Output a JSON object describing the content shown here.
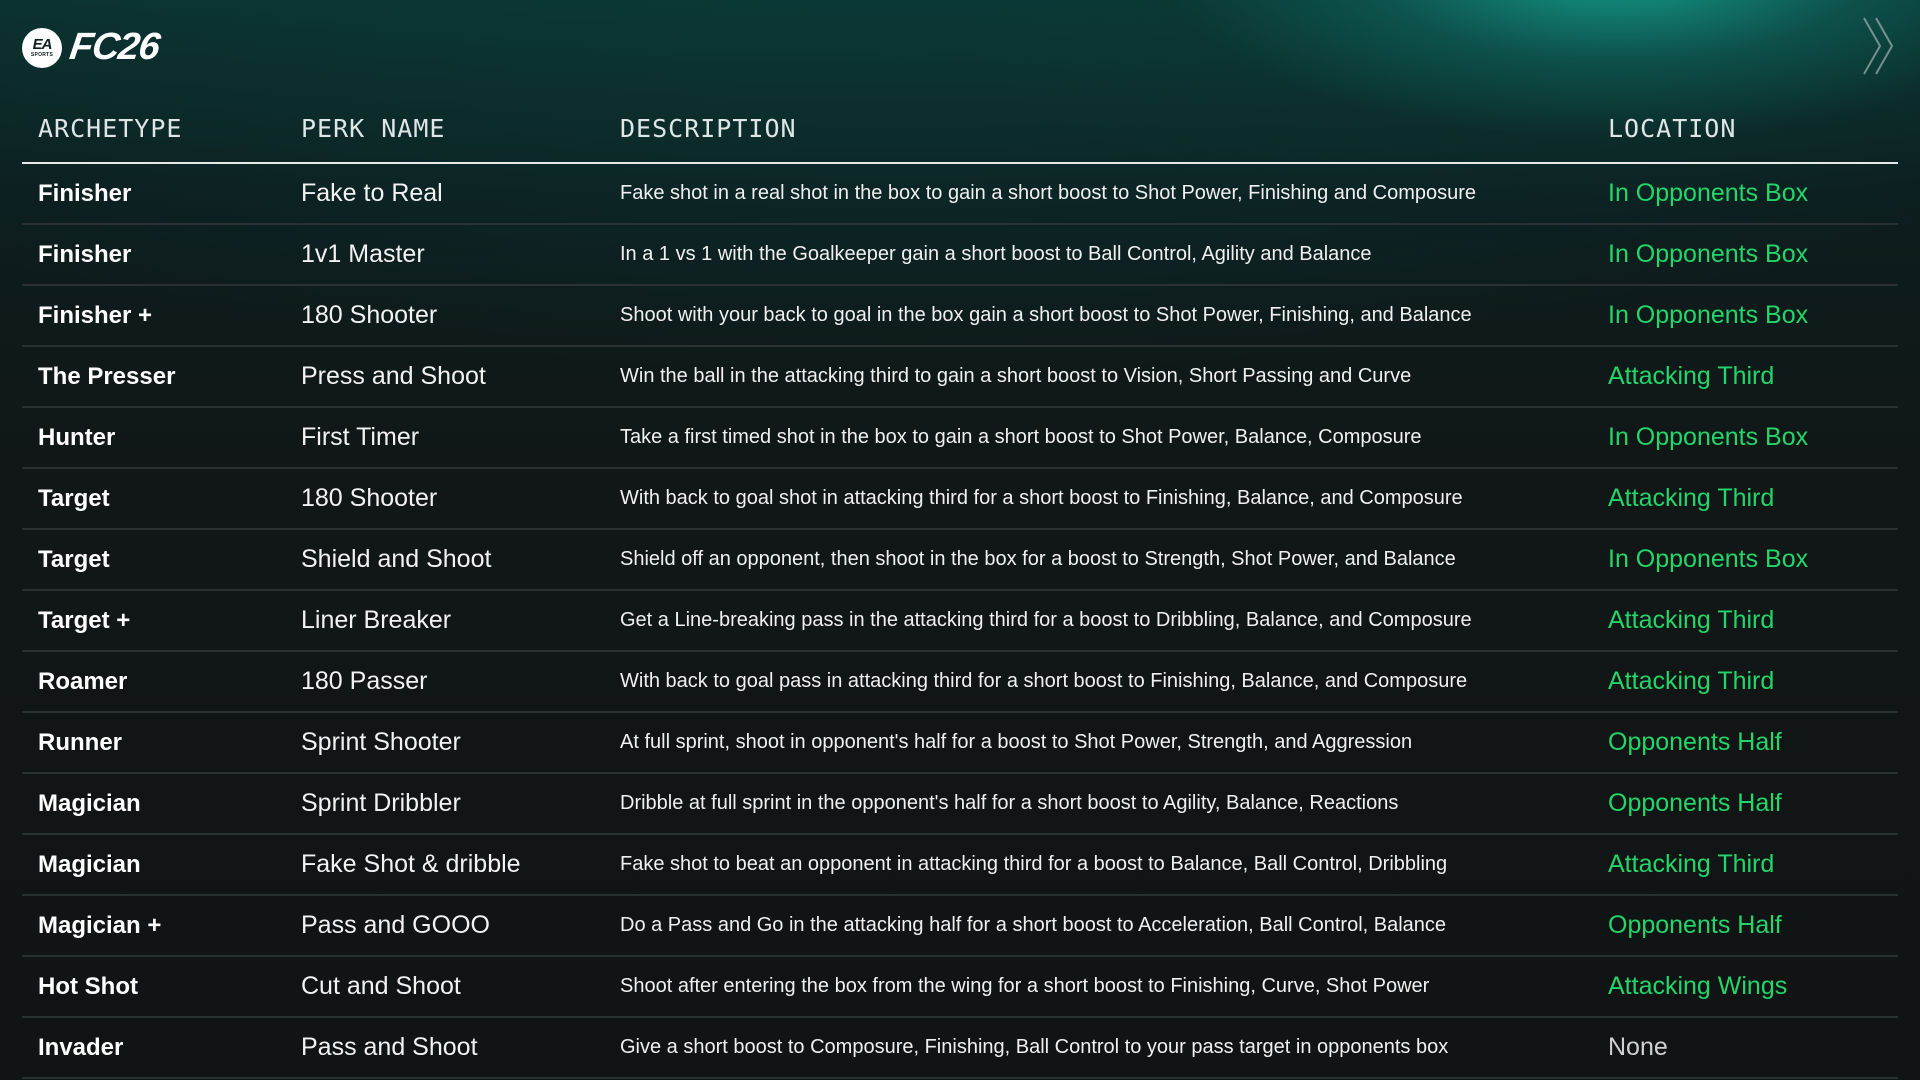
{
  "brand": {
    "badge_top": "EA",
    "badge_bottom": "SPORTS",
    "game": "FC26"
  },
  "icons": {
    "brand": "ea-sports-logo-icon",
    "nav": "double-chevron-right-icon"
  },
  "colors": {
    "location_green": "#22d66a",
    "none_gray": "#d0d0d0",
    "accent_teal": "#18beaa"
  },
  "table": {
    "headers": {
      "archetype": "ARCHETYPE",
      "perk": "PERK  NAME",
      "description": "DESCRIPTION",
      "location": "LOCATION"
    },
    "rows": [
      {
        "archetype": "Finisher",
        "perk": "Fake to Real",
        "description": "Fake shot in a real shot in the box to gain a short boost to Shot Power, Finishing and Composure",
        "location": "In Opponents Box"
      },
      {
        "archetype": "Finisher",
        "perk": "1v1 Master",
        "description": "In a 1 vs 1 with the Goalkeeper gain a short boost to Ball Control, Agility and Balance",
        "location": "In Opponents Box"
      },
      {
        "archetype": "Finisher +",
        "perk": "180 Shooter",
        "description": "Shoot with your back to goal in the box gain a short boost to Shot Power, Finishing, and Balance",
        "location": "In Opponents Box"
      },
      {
        "archetype": "The Presser",
        "perk": "Press and Shoot",
        "description": "Win the ball in the attacking third to gain a short boost to Vision, Short Passing and Curve",
        "location": "Attacking Third"
      },
      {
        "archetype": "Hunter",
        "perk": "First Timer",
        "description": "Take a first timed shot in the box to gain a short boost to Shot Power, Balance, Composure",
        "location": "In Opponents Box"
      },
      {
        "archetype": "Target",
        "perk": "180 Shooter",
        "description": "With back to goal shot in attacking third for a short boost to Finishing, Balance, and Composure",
        "location": "Attacking Third"
      },
      {
        "archetype": "Target",
        "perk": "Shield and Shoot",
        "description": "Shield off an opponent, then shoot in the box for a boost to Strength, Shot Power, and Balance",
        "location": "In Opponents Box"
      },
      {
        "archetype": "Target +",
        "perk": "Liner Breaker",
        "description": "Get a Line-breaking pass in the attacking third for a boost to Dribbling, Balance, and Composure",
        "location": "Attacking Third"
      },
      {
        "archetype": "Roamer",
        "perk": "180 Passer",
        "description": "With back to goal pass in attacking third for a short boost to Finishing, Balance, and Composure",
        "location": "Attacking Third"
      },
      {
        "archetype": "Runner",
        "perk": "Sprint Shooter",
        "description": "At full sprint, shoot in opponent's half for a boost to Shot Power, Strength, and Aggression",
        "location": "Opponents Half"
      },
      {
        "archetype": "Magician",
        "perk": "Sprint Dribbler",
        "description": "Dribble at full sprint in the opponent's half for a short boost to Agility, Balance, Reactions",
        "location": "Opponents Half"
      },
      {
        "archetype": "Magician",
        "perk": "Fake Shot & dribble",
        "description": "Fake shot to beat an opponent in attacking third for a boost to Balance, Ball Control, Dribbling",
        "location": "Attacking Third"
      },
      {
        "archetype": "Magician +",
        "perk": "Pass and GOOO",
        "description": "Do a Pass and Go in the attacking half for a short boost to Acceleration, Ball Control, Balance",
        "location": "Opponents Half"
      },
      {
        "archetype": "Hot Shot",
        "perk": "Cut and Shoot",
        "description": "Shoot after entering the box from the wing for a short boost to Finishing, Curve, Shot Power",
        "location": "Attacking Wings"
      },
      {
        "archetype": "Invader",
        "perk": "Pass and Shoot",
        "description": "Give a short boost to Composure, Finishing, Ball Control to your pass target in opponents box",
        "location": "None"
      }
    ]
  }
}
